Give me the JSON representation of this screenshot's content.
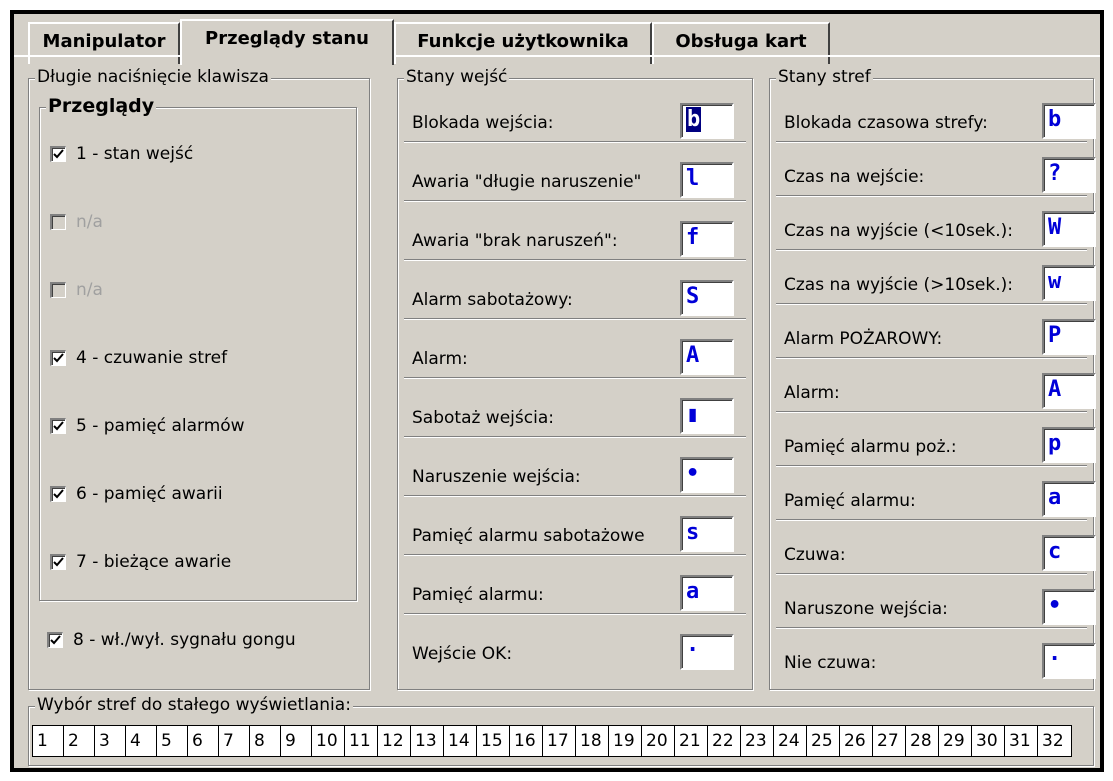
{
  "tabs": [
    "Manipulator",
    "Przeglądy stanu",
    "Funkcje użytkownika",
    "Obsługa kart"
  ],
  "active_tab": "Przeglądy stanu",
  "long_press": {
    "title": "Długie naciśnięcie klawisza",
    "reviews_title": "Przeglądy",
    "items": [
      {
        "label": "1 - stan wejść",
        "checked": true,
        "enabled": true
      },
      {
        "label": "n/a",
        "checked": false,
        "enabled": false
      },
      {
        "label": "n/a",
        "checked": false,
        "enabled": false
      },
      {
        "label": "4 - czuwanie stref",
        "checked": true,
        "enabled": true
      },
      {
        "label": "5 - pamięć alarmów",
        "checked": true,
        "enabled": true
      },
      {
        "label": "6 - pamięć awarii",
        "checked": true,
        "enabled": true
      },
      {
        "label": "7 - bieżące awarie",
        "checked": true,
        "enabled": true
      }
    ],
    "gong": {
      "label": "8 - wł./wył. sygnału gongu",
      "checked": true
    }
  },
  "input_states": {
    "title": "Stany wejść",
    "rows": [
      {
        "label": "Blokada wejścia:",
        "symbol": "b",
        "selected": true
      },
      {
        "label": "Awaria \"długie naruszenie\"",
        "symbol": "l"
      },
      {
        "label": "Awaria \"brak naruszeń\":",
        "symbol": "f"
      },
      {
        "label": "Alarm sabotażowy:",
        "symbol": "S"
      },
      {
        "label": "Alarm:",
        "symbol": "A"
      },
      {
        "label": "Sabotaż wejścia:",
        "symbol": "▮"
      },
      {
        "label": "Naruszenie wejścia:",
        "symbol": "•"
      },
      {
        "label": "Pamięć alarmu sabotażowe",
        "symbol": "s"
      },
      {
        "label": "Pamięć alarmu:",
        "symbol": "a"
      },
      {
        "label": "Wejście OK:",
        "symbol": "·"
      }
    ]
  },
  "zone_states": {
    "title": "Stany stref",
    "rows": [
      {
        "label": "Blokada czasowa strefy:",
        "symbol": "b"
      },
      {
        "label": "Czas na wejście:",
        "symbol": "?"
      },
      {
        "label": "Czas na wyjście (<10sek.):",
        "symbol": "W"
      },
      {
        "label": "Czas na wyjście (>10sek.):",
        "symbol": "w"
      },
      {
        "label": "Alarm POŻAROWY:",
        "symbol": "P"
      },
      {
        "label": "Alarm:",
        "symbol": "A"
      },
      {
        "label": "Pamięć alarmu poż.:",
        "symbol": "p"
      },
      {
        "label": "Pamięć alarmu:",
        "symbol": "a"
      },
      {
        "label": "Czuwa:",
        "symbol": "c"
      },
      {
        "label": "Naruszone wejścia:",
        "symbol": "•"
      },
      {
        "label": "Nie czuwa:",
        "symbol": "·"
      }
    ]
  },
  "zones_display": {
    "title": "Wybór stref do stałego wyświetlania:",
    "zones": [
      "1",
      "2",
      "3",
      "4",
      "5",
      "6",
      "7",
      "8",
      "9",
      "10",
      "11",
      "12",
      "13",
      "14",
      "15",
      "16",
      "17",
      "18",
      "19",
      "20",
      "21",
      "22",
      "23",
      "24",
      "25",
      "26",
      "27",
      "28",
      "29",
      "30",
      "31",
      "32"
    ]
  },
  "icons": {
    "checkbox_check": "check-mark-icon"
  },
  "colors": {
    "background": "#d4d0c8",
    "symbol": "#0000d8",
    "selection": "#000080"
  }
}
